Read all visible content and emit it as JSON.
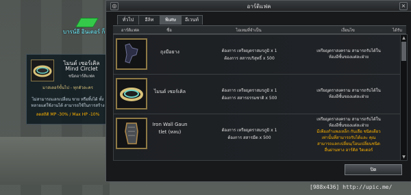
{
  "npc": {
    "name": "บารน์ฮี อินเตอร์ ก็ล"
  },
  "tooltip": {
    "item_name_line1": "ไมนด์ เซอร์เคิล",
    "item_name_line2": "Mind Circlet",
    "item_type": "ชนิดอาร์ติแฟค",
    "requirement": "มาสเตอร์ขั้นไป - ทุกตัวละคร",
    "note": "ไม่สามารถแลกเปลี่ยน ขาย หรือทิ้งได้ ทั้งหลายแต่ใช้งานได้ สามารถใช้ในการสร้าง",
    "stats": "ลดสถิติ MP -30% / Max HP -10%"
  },
  "window": {
    "title": "อาร์ติแฟค",
    "tabs": [
      "ทั่วไป",
      "อีลิท",
      "พิเศษ",
      "อีเวนท์"
    ],
    "active_tab": 2,
    "columns": [
      "อาร์ติแฟค",
      "ชื่อ",
      "ไอเทมที่จำเป็น",
      "เงื่อนไข",
      "ได้รับ"
    ],
    "rows": [
      {
        "icon": "glove-icon",
        "name": "ถุงมือยาง",
        "requires": "ต้องการ เหรียญตราสมรภูมิ x 1\nต้องการ สสารบริสุทธิ์ x 500",
        "condition": "เหรียญตราสงคราม สามารถรับได้ใน\nห้องอีชั้นของแต่ละฝ่าย"
      },
      {
        "icon": "circlet-icon",
        "name": "ไมนด์ เซอร์เคิล",
        "requires": "ต้องการ เหรียญตราสมรภูมิ x 1\nต้องการ สสารธรรมชาติ x 500",
        "condition": "เหรียญตราสงคราม สามารถรับได้ใน\nห้องอีชั้นของแต่ละฝ่าย"
      },
      {
        "icon": "gauntlet-icon",
        "name": "Iron Wall Gaun tlet (หลบ)",
        "requires": "ต้องการ เหรียญตราสมรภูมิ x 1\nต้องการ สสารมืด x 500",
        "condition": "เหรียญตราสงคราม สามารถรับได้ใน\nห้องอีชั้นของแต่ละฝ่าย",
        "condition_note": "มีเพียงกำแพงเหล็ก กันเลือ ชนิดเดียว\nเท่านั้นที่สามารถรับได้และ คุณ\nสามารถแลกเปลี่ยน/โอนเปลี่ยนชนิด\nอื่นผ่านทาง อาร์ติส วิดเตอร์"
      }
    ],
    "ok_label": "ปิด"
  },
  "watermark": "[988x436] http://upic.me/",
  "colors": {
    "frame": "#55595c",
    "gold": "#8f7a45",
    "orange": "#ffb400",
    "cyan": "#6ff0ff"
  }
}
